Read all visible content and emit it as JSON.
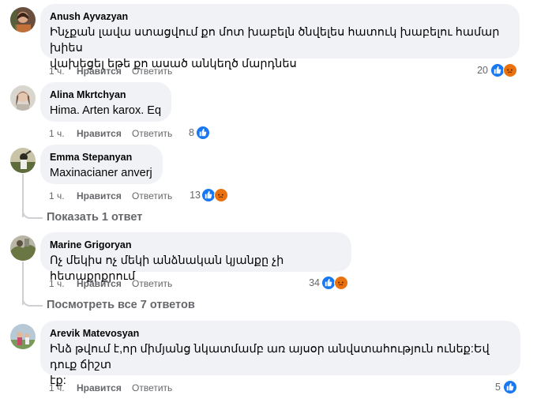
{
  "actions": {
    "time": "1 ч.",
    "like": "Нравится",
    "reply": "Ответить"
  },
  "comments": [
    {
      "author": "Anush Ayvazyan",
      "text": "Ինչքան լավա ստացվում քո մոտ խաբելն ծնվելես հատուկ խաբելու համար խիես\nվախեցել եթե քո ասած անկեղծ մարդնես",
      "reactions": "20",
      "reaction_icons": [
        "like-icon",
        "angry-icon"
      ]
    },
    {
      "author": "Alina Mkrtchyan",
      "text": "Hima. Arten karox. Eq",
      "reactions": "8",
      "reaction_icons": [
        "like-icon"
      ]
    },
    {
      "author": "Emma Stepanyan",
      "text": "Maxinacianer anverj",
      "reactions": "13",
      "reaction_icons": [
        "like-icon",
        "angry-icon"
      ],
      "more": "Показать 1 ответ"
    },
    {
      "author": "Marine Grigoryan",
      "text": "Ոչ մեկիս ոչ մեկի անձնական կյանքը չի հետաքրքրում",
      "reactions": "34",
      "reaction_icons": [
        "like-icon",
        "angry-icon"
      ],
      "more": "Посмотреть все 7 ответов"
    },
    {
      "author": "Arevik Matevosyan",
      "text": "Ինձ թվում է,որ միմյանց նկատմամբ առ այսօր անվստահություն ունեք:Եվ դուք ճիշտ\nէք:",
      "reactions": "5",
      "reaction_icons": [
        "like-icon"
      ]
    }
  ],
  "colors": {
    "like": "#1877f2",
    "angry": "#e9710f",
    "bubble": "#f0f2f5",
    "meta": "#65676b"
  }
}
